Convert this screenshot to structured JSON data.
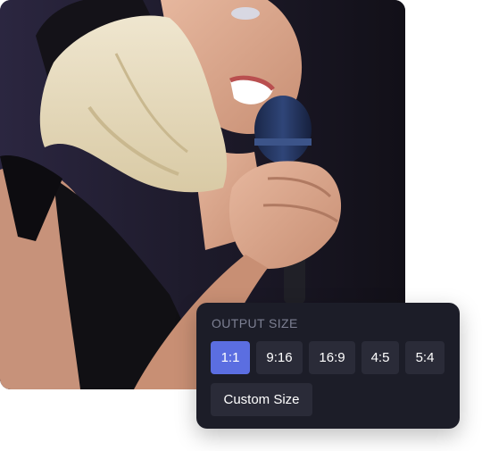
{
  "photo": {
    "subject": "singer-with-microphone"
  },
  "output_size": {
    "title": "OUTPUT SIZE",
    "options": [
      {
        "label": "1:1",
        "selected": true
      },
      {
        "label": "9:16",
        "selected": false
      },
      {
        "label": "16:9",
        "selected": false
      },
      {
        "label": "4:5",
        "selected": false
      },
      {
        "label": "5:4",
        "selected": false
      }
    ],
    "custom_label": "Custom Size"
  },
  "colors": {
    "panel_bg": "#1c1d28",
    "button_bg": "#2a2b38",
    "selected_accent": "#5b6ee1",
    "title_text": "#7d8093"
  }
}
